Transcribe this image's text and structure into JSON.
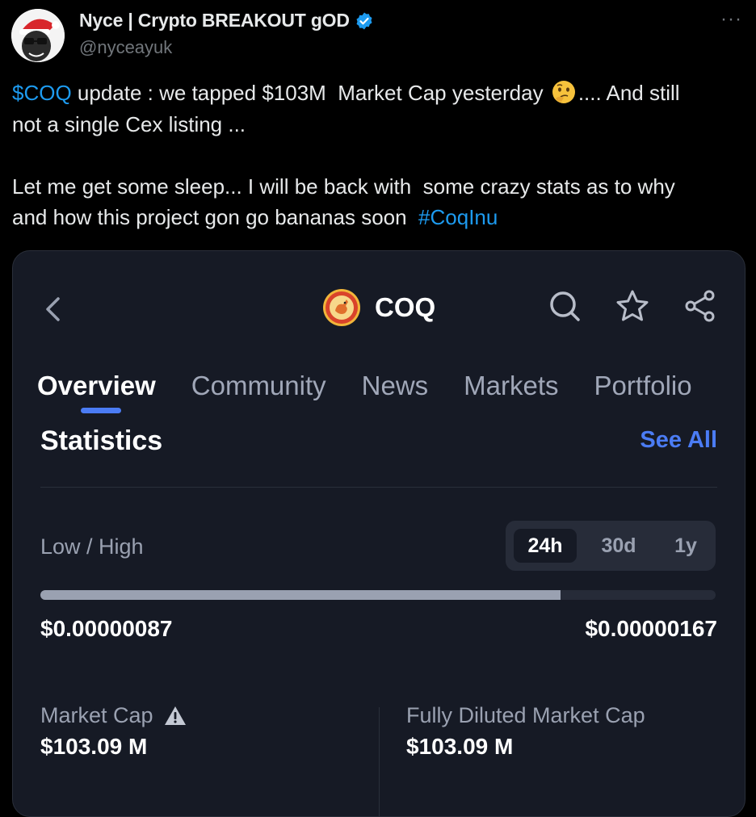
{
  "author": {
    "name": "Nyce | Crypto BREAKOUT gOD",
    "handle": "@nyceayuk",
    "more_label": "···"
  },
  "tweet": {
    "cashtag": "$COQ",
    "line1_text": " update : we tapped $103M  Market Cap yesterday ",
    "line1_tail": ".... And still",
    "line2": "not a single Cex listing ...",
    "line3": "Let me get some sleep... I will be back with  some crazy stats as to why",
    "line4_text": "and how this project gon go bananas soon  ",
    "hashtag": "#CoqInu",
    "emoji_icon": "thinking-face-icon"
  },
  "app": {
    "coin_symbol": "COQ",
    "tabs": [
      "Overview",
      "Community",
      "News",
      "Markets",
      "Portfolio"
    ],
    "active_tab": "Overview",
    "statistics": {
      "title": "Statistics",
      "see_all": "See All",
      "range_label": "Low / High",
      "periods": [
        "24h",
        "30d",
        "1y"
      ],
      "selected_period": "24h",
      "low": "$0.00000087",
      "high": "$0.00000167",
      "range_fill_fraction": 0.77,
      "market_cap_label": "Market Cap",
      "market_cap_value": "$103.09 M",
      "fdmc_label": "Fully Diluted Market Cap",
      "fdmc_value": "$103.09 M"
    }
  },
  "colors": {
    "link": "#1d9bf0",
    "accent": "#4b7cf4",
    "card_bg": "#161a25"
  }
}
